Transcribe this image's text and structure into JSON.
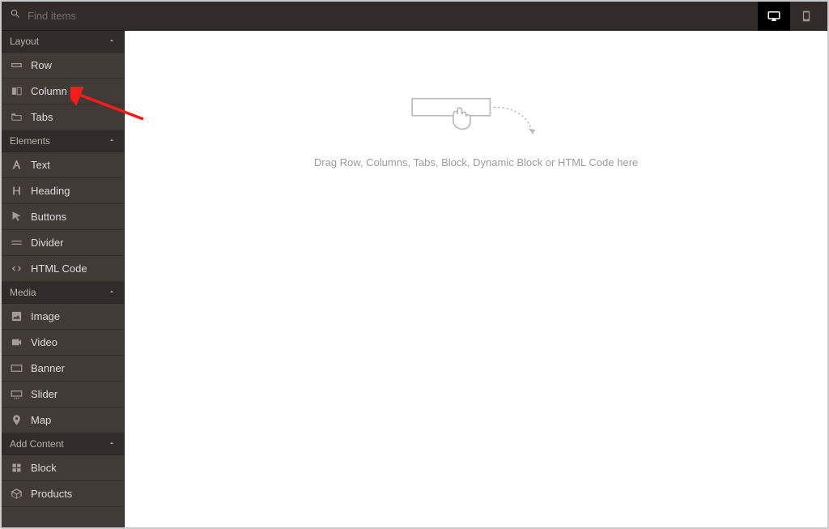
{
  "search": {
    "placeholder": "Find items"
  },
  "sidebar": {
    "sections": {
      "layout": {
        "title": "Layout",
        "items": [
          {
            "label": "Row"
          },
          {
            "label": "Column"
          },
          {
            "label": "Tabs"
          }
        ]
      },
      "elements": {
        "title": "Elements",
        "items": [
          {
            "label": "Text"
          },
          {
            "label": "Heading"
          },
          {
            "label": "Buttons"
          },
          {
            "label": "Divider"
          },
          {
            "label": "HTML Code"
          }
        ]
      },
      "media": {
        "title": "Media",
        "items": [
          {
            "label": "Image"
          },
          {
            "label": "Video"
          },
          {
            "label": "Banner"
          },
          {
            "label": "Slider"
          },
          {
            "label": "Map"
          }
        ]
      },
      "add_content": {
        "title": "Add Content",
        "items": [
          {
            "label": "Block"
          },
          {
            "label": "Products"
          }
        ]
      }
    }
  },
  "canvas": {
    "drop_hint": "Drag Row, Columns, Tabs, Block, Dynamic Block or HTML Code here"
  }
}
